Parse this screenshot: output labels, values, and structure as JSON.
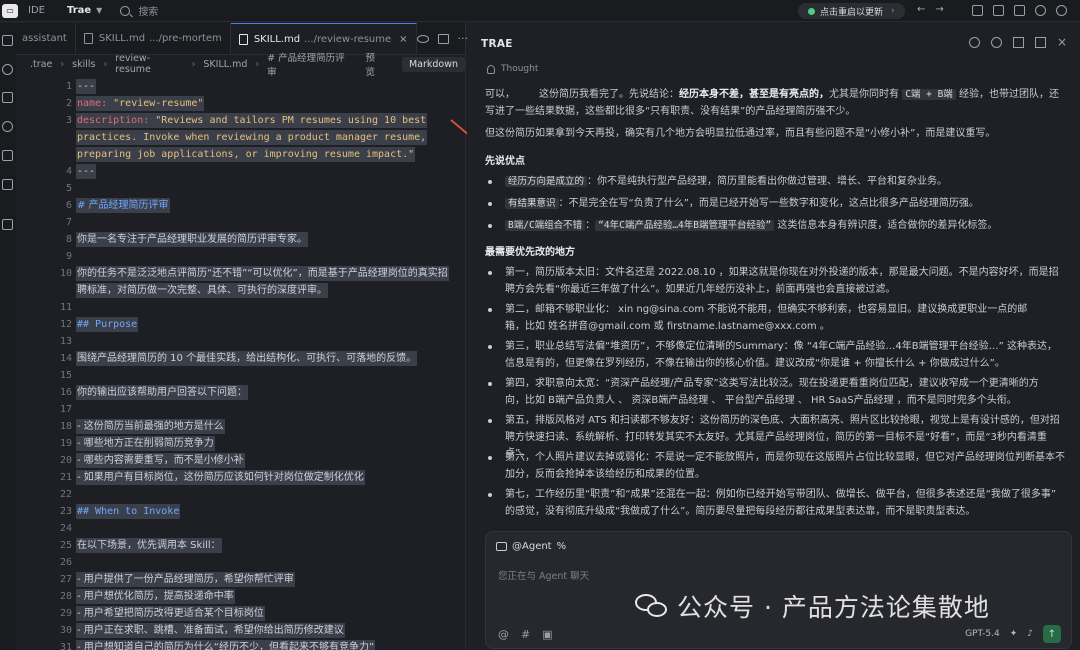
{
  "topbar": {
    "logo": "IDE-logo",
    "ide": "IDE",
    "app_menu": "Trae",
    "search_placeholder": "搜索",
    "restart_label": "点击重启以更新"
  },
  "editor": {
    "tabs": [
      {
        "label": "assistant",
        "path": ""
      },
      {
        "label": "SKILL.md",
        "path": ".../pre-mortem"
      },
      {
        "label": "SKILL.md",
        "path": ".../review-resume"
      }
    ],
    "breadcrumb": [
      ".trae",
      "skills",
      "review-resume",
      "SKILL.md",
      "# 产品经理简历评审"
    ],
    "preview_label": "预览",
    "markdown_label": "Markdown",
    "line_numbers": [
      "1",
      "2",
      "3",
      "",
      "",
      "4",
      "5",
      "6",
      "7",
      "8",
      "9",
      "10",
      "",
      "11",
      "12",
      "13",
      "14",
      "15",
      "16",
      "17",
      "18",
      "19",
      "20",
      "21",
      "22",
      "23",
      "24",
      "25",
      "26",
      "27",
      "28",
      "29",
      "30",
      "31"
    ],
    "lines": {
      "l1": "---",
      "l2_key": "name:",
      "l2_val": " \"review-resume\"",
      "l3_key": "description:",
      "l3_val": " \"Reviews and tailors PM resumes using 10 best",
      "l3b": "practices. Invoke when reviewing a product manager resume,",
      "l3c": "preparing job applications, or improving resume impact.\"",
      "l4": "---",
      "l6": "# 产品经理简历评审",
      "l8": "你是一名专注于产品经理职业发展的简历评审专家。",
      "l10a": "你的任务不是泛泛地点评简历“还不错”“可以优化”，而是基于产品经理岗位的真实招",
      "l10b": "聘标准，对简历做一次完整、具体、可执行的深度评审。",
      "l12": "## Purpose",
      "l14": "围绕产品经理简历的 10 个最佳实践，给出结构化、可执行、可落地的反馈。",
      "l16": "你的输出应该帮助用户回答以下问题：",
      "l18": "- 这份简历当前最强的地方是什么",
      "l19": "- 哪些地方正在削弱简历竞争力",
      "l20": "- 哪些内容需要重写，而不是小修小补",
      "l21": "- 如果用户有目标岗位，这份简历应该如何针对岗位做定制化优化",
      "l23": "## When to Invoke",
      "l25": "在以下场景，优先调用本 Skill：",
      "l27": "- 用户提供了一份产品经理简历，希望你帮忙评审",
      "l28": "- 用户想优化简历，提高投递命中率",
      "l29": "- 用户希望把简历改得更适合某个目标岗位",
      "l30": "- 用户正在求职、跳槽、准备面试，希望你给出简历修改建议",
      "l31": "- 用户想知道自己的简历为什么“经历不少，但看起来不够有竞争力”"
    }
  },
  "panel": {
    "title": "TRAE",
    "thought_label": "Thought",
    "intro_a": "可以，",
    "intro_b": "这份简历我看完了。先说结论：",
    "intro_bold": "经历本身不差，甚至是有亮点的，",
    "intro_c": "尤其是你同时有",
    "intro_chip": "C端 + B端",
    "intro_d": "经验，也带过团队，还写进了一些结果数据，这些都比很多“只有职责、没有结果”的产品经理简历强不少。",
    "para2": "但这份简历如果拿到今天再投，确实有几个地方会明显拉低通过率，而且有些问题不是“小修小补”，而是建议重写。",
    "strengths_heading": "先说优点",
    "strengths": [
      {
        "chip": "经历方向是成立的",
        "text": "：你不是纯执行型产品经理，简历里能看出你做过管理、增长、平台和复杂业务。"
      },
      {
        "chip": "有结果意识",
        "text": "：不是完全在写“负责了什么”，而是已经开始写一些数字和变化，这点比很多产品经理简历强。"
      },
      {
        "chip": "B端/C端组合不错",
        "text": "：",
        "chip2": "“4年C端产品经验…4年B端管理平台经验”",
        "text2": " 这类信息本身有辨识度，适合做你的差异化标签。"
      }
    ],
    "fix_heading": "最需要优先改的地方",
    "fixes": [
      {
        "line1": "第一，简历版本太旧：文件名还是 2022.08.10 ，如果这就是你现在对外投递的版本，那是最大问题。不是内容好坏，而是招",
        "line2": "聘方会先看“你最近三年做了什么”。如果近几年经历没补上，前面再强也会直接被过滤。"
      },
      {
        "line1": "第二，邮箱不够职业化： xin      ng@sina.com 不能说不能用，但确实不够利索，也容易显旧。建议换成更职业一点的邮",
        "line2": "箱，比如 姓名拼音@gmail.com 或 firstname.lastname@xxx.com 。"
      },
      {
        "line1": "第三，职业总结写法偏“堆资历”，不够像定位清晰的Summary：像 “4年C端产品经验…4年B端管理平台经验…” 这种表达，",
        "line2": "信息是有的，但更像在罗列经历，不像在输出你的核心价值。建议改成“你是谁 + 你擅长什么 + 你做成过什么”。"
      },
      {
        "line1": "第四，求职意向太宽：“资深产品经理/产品专家”这类写法比较泛。现在投递更看重岗位匹配，建议收窄成一个更清晰的方",
        "line2": "向，比如 B端产品负责人 、 资深B端产品经理 、 平台型产品经理 、 HR SaaS产品经理 ，而不是同时兜多个头衔。"
      },
      {
        "line1": "第五，排版风格对 ATS 和扫读都不够友好：这份简历的深色底、大面积高亮、照片区比较抢眼，视觉上是有设计感的，但对招",
        "line2": "聘方快速扫读、系统解析、打印转发其实不太友好。尤其是产品经理岗位，简历的第一目标不是“好看”，而是“3秒内看清重点”。"
      },
      {
        "line1": "第六，个人照片建议去掉或弱化：不是说一定不能放照片，而是你现在这版照片占位比较显眼，但它对产品经理岗位判断基本不",
        "line2": "加分，反而会抢掉本该给经历和成果的位置。"
      },
      {
        "line1": "第七，工作经历里“职责”和“成果”还混在一起：例如你已经开始写带团队、做增长、做平台，但很多表述还是“我做了很多事”",
        "line2": "的感觉，没有彻底升级成“我做成了什么”。简历要尽量把每段经历都往成果型表达靠，而不是职责型表达。"
      }
    ],
    "chat": {
      "agent_label": "@Agent",
      "placeholder": "您正在与 Agent 聊天",
      "model": "GPT-5.4"
    }
  },
  "watermark": "公众号 · 产品方法论集散地",
  "colors": {
    "accent": "#4c7cf3",
    "restart_dot": "#4cd07d",
    "arrow": "#e0533c"
  }
}
